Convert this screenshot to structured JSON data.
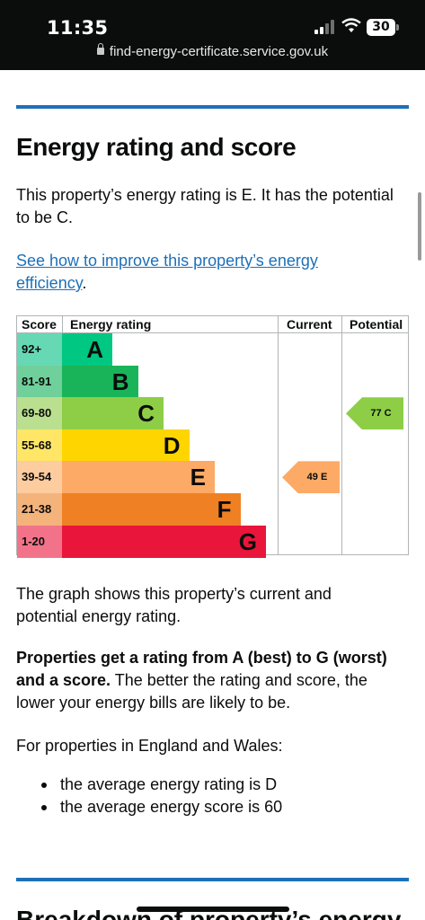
{
  "status_bar": {
    "time": "11:35",
    "battery": "30"
  },
  "browser": {
    "url": "find-energy-certificate.service.gov.uk"
  },
  "section": {
    "heading": "Energy rating and score",
    "intro_line1": "This property’s energy rating is E. It has the potential",
    "intro_line2": "to be C.",
    "link_line1": "See how to improve this property’s energy",
    "link_line2": "efficiency",
    "link_suffix": "."
  },
  "chart_data": {
    "type": "table",
    "headers": {
      "score": "Score",
      "rating": "Energy rating",
      "current": "Current",
      "potential": "Potential"
    },
    "bands": [
      {
        "score": "92+",
        "letter": "A",
        "color": "#00c781"
      },
      {
        "score": "81-91",
        "letter": "B",
        "color": "#19b459"
      },
      {
        "score": "69-80",
        "letter": "C",
        "color": "#8dce46"
      },
      {
        "score": "55-68",
        "letter": "D",
        "color": "#ffd500"
      },
      {
        "score": "39-54",
        "letter": "E",
        "color": "#fcaa65"
      },
      {
        "score": "21-38",
        "letter": "F",
        "color": "#ef8023"
      },
      {
        "score": "1-20",
        "letter": "G",
        "color": "#e9153b"
      }
    ],
    "current": {
      "label": "49 E",
      "score": 49,
      "band": "E",
      "color": "#fcaa65"
    },
    "potential": {
      "label": "77 C",
      "score": 77,
      "band": "C",
      "color": "#8dce46"
    }
  },
  "body": {
    "graph_line1": "The graph shows this property’s current and",
    "graph_line2": "potential energy rating.",
    "bold_line1": "Properties get a rating from A (best) to G (worst)",
    "bold_line2a": "and a score.",
    "bold_line2b": " The better the rating and score, the",
    "bold_line3": "lower your energy bills are likely to be.",
    "england_line": "For properties in England and Wales:",
    "bullets": [
      "the average energy rating is D",
      "the average energy score is 60"
    ],
    "next_heading": "Breakdown of property’s energy"
  }
}
